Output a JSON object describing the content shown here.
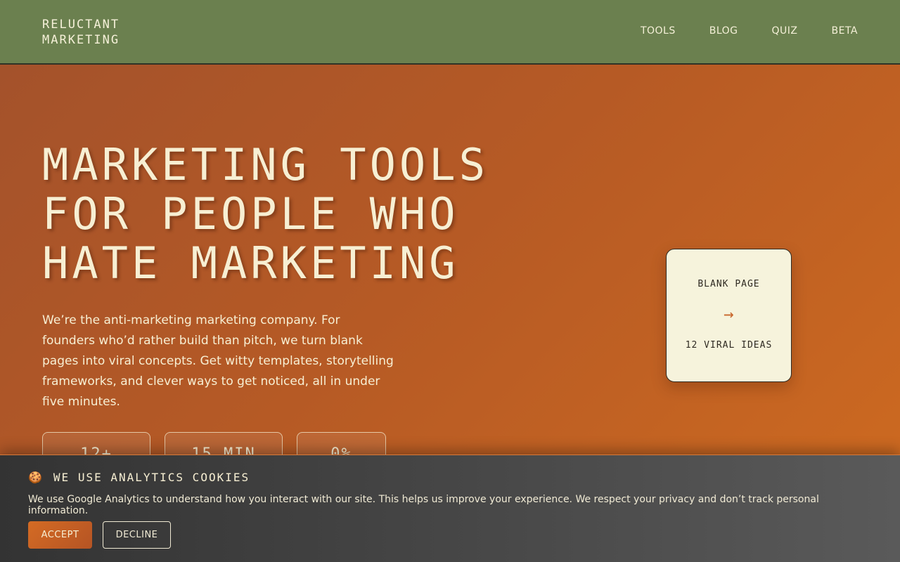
{
  "header": {
    "logo_line1": "RELUCTANT",
    "logo_line2": "MARKETING",
    "nav": [
      {
        "label": "TOOLS"
      },
      {
        "label": "BLOG"
      },
      {
        "label": "QUIZ"
      },
      {
        "label": "BETA"
      }
    ]
  },
  "hero": {
    "headline": [
      "MARKETING TOOLS",
      "FOR PEOPLE WHO",
      "HATE MARKETING"
    ],
    "lead": "We’re the anti-marketing marketing company. For founders who’d rather build than pitch, we turn blank pages into viral concepts. Get witty templates, storytelling frameworks, and clever ways to get noticed, all in under five minutes.",
    "stats": [
      "12+",
      "15 MIN",
      "0%"
    ],
    "card": {
      "from": "BLANK PAGE",
      "arrow": "→",
      "to": "12 VIRAL IDEAS"
    }
  },
  "cookie": {
    "icon": "cookie-icon",
    "title": "WE USE ANALYTICS COOKIES",
    "text": "We use Google Analytics to understand how you interact with our site. This helps us improve your experience. We respect your privacy and don’t track personal information.",
    "accept_label": "ACCEPT",
    "decline_label": "DECLINE"
  },
  "colors": {
    "header_bg": "#6b804f",
    "hero_start": "#a4522b",
    "hero_end": "#cf6b20",
    "cream": "#f7efd3",
    "accent": "#c8652a"
  }
}
